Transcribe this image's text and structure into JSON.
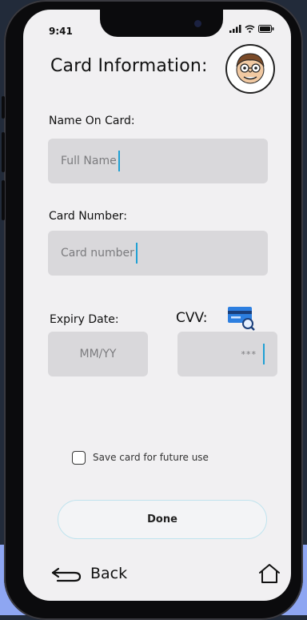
{
  "status_bar": {
    "time": "9:41"
  },
  "header": {
    "title": "Card Information:"
  },
  "form": {
    "name_label": "Name On Card:",
    "name_placeholder": "Full Name",
    "number_label": "Card Number:",
    "number_placeholder": "Card number",
    "expiry_label": "Expiry Date:",
    "expiry_placeholder": "MM/YY",
    "cvv_label": "CVV:",
    "cvv_placeholder": "***",
    "save_card_label": "Save card for future use",
    "save_card_checked": false
  },
  "actions": {
    "done_label": "Done"
  },
  "nav": {
    "back_label": "Back"
  },
  "colors": {
    "caret": "#1fa0d4",
    "field_bg": "#d9d8db",
    "screen_bg": "#f1f0f2"
  }
}
